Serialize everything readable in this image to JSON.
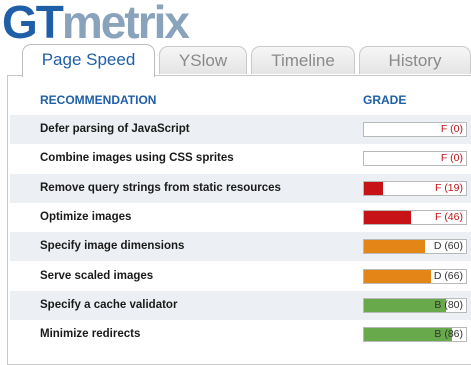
{
  "logo": {
    "part1": "GT",
    "part2": "metrix"
  },
  "tabs": [
    {
      "label": "Page Speed"
    },
    {
      "label": "YSlow"
    },
    {
      "label": "Timeline"
    },
    {
      "label": "History"
    }
  ],
  "table": {
    "header_recommendation": "RECOMMENDATION",
    "header_grade": "GRADE",
    "rows": [
      {
        "label": "Defer parsing of JavaScript",
        "grade": "F (0)",
        "score": 0,
        "color": "#c0141a",
        "text_color": "#c0141a"
      },
      {
        "label": "Combine images using CSS sprites",
        "grade": "F (0)",
        "score": 0,
        "color": "#c0141a",
        "text_color": "#c0141a"
      },
      {
        "label": "Remove query strings from static resources",
        "grade": "F (19)",
        "score": 19,
        "color": "#c0141a",
        "text_color": "#c0141a"
      },
      {
        "label": "Optimize images",
        "grade": "F (46)",
        "score": 46,
        "color": "#c0141a",
        "text_color": "#c0141a"
      },
      {
        "label": "Specify image dimensions",
        "grade": "D (60)",
        "score": 60,
        "color": "#e0861e",
        "text_color": "#333333"
      },
      {
        "label": "Serve scaled images",
        "grade": "D (66)",
        "score": 66,
        "color": "#e0861e",
        "text_color": "#333333"
      },
      {
        "label": "Specify a cache validator",
        "grade": "B (80)",
        "score": 80,
        "color": "#6aa84f",
        "text_color": "#333333"
      },
      {
        "label": "Minimize redirects",
        "grade": "B (86)",
        "score": 86,
        "color": "#6aa84f",
        "text_color": "#333333"
      }
    ]
  }
}
